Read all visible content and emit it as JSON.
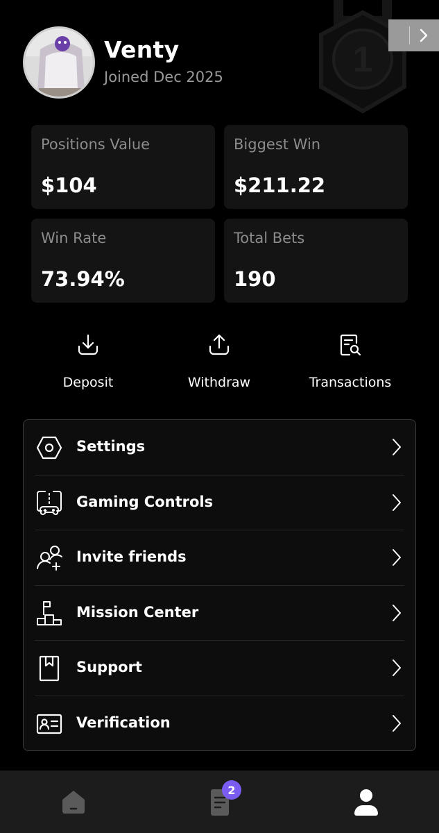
{
  "header": {
    "rank_number": "1",
    "username": "Venty",
    "joined": "Joined Dec 2025"
  },
  "stats": [
    {
      "label": "Positions Value",
      "value": "$104"
    },
    {
      "label": "Biggest Win",
      "value": "$211.22"
    },
    {
      "label": "Win Rate",
      "value": "73.94%"
    },
    {
      "label": "Total Bets",
      "value": "190"
    }
  ],
  "actions": [
    {
      "label": "Deposit",
      "icon": "download-icon"
    },
    {
      "label": "Withdraw",
      "icon": "upload-icon"
    },
    {
      "label": "Transactions",
      "icon": "receipt-search-icon"
    }
  ],
  "menu": [
    {
      "label": "Settings",
      "icon": "hexagon-gear-icon"
    },
    {
      "label": "Gaming Controls",
      "icon": "gamepad-icon"
    },
    {
      "label": "Invite friends",
      "icon": "add-user-icon"
    },
    {
      "label": "Mission Center",
      "icon": "podium-flag-icon"
    },
    {
      "label": "Support",
      "icon": "bookmark-book-icon"
    },
    {
      "label": "Verification",
      "icon": "id-card-icon"
    }
  ],
  "bottom_nav": {
    "items": [
      {
        "name": "home",
        "icon": "home-icon"
      },
      {
        "name": "bets",
        "icon": "document-icon",
        "badge": "2"
      },
      {
        "name": "profile",
        "icon": "user-icon",
        "active": true
      }
    ]
  },
  "colors": {
    "background": "#000000",
    "card": "#141414",
    "muted_text": "#8c8c8c",
    "badge": "#7b5cf0",
    "nav_bar": "#1c1c1c"
  }
}
